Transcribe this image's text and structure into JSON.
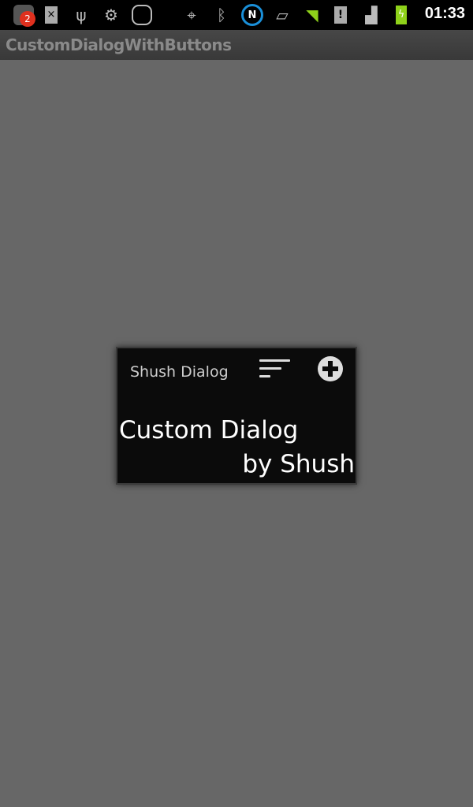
{
  "status_bar": {
    "notification_count": "2",
    "time": "01:33",
    "icons": [
      "app-notification-icon",
      "sim-missing-icon",
      "usb-icon",
      "android-debug-icon",
      "sync-icon",
      "gps-icon",
      "bluetooth-icon",
      "nfc-icon",
      "rotation-icon",
      "wifi-icon",
      "sd-card-alert-icon",
      "signal-icon",
      "battery-charging-icon"
    ],
    "wifi_color": "#8fd21a",
    "battery_color": "#8fd21a",
    "nfc_color": "#1a8fd8",
    "badge_color": "#e0301e"
  },
  "app": {
    "title": "CustomDialogWithButtons"
  },
  "dialog": {
    "title": "Shush Dialog",
    "line1": "Custom Dialog",
    "line2": "by Shush"
  }
}
